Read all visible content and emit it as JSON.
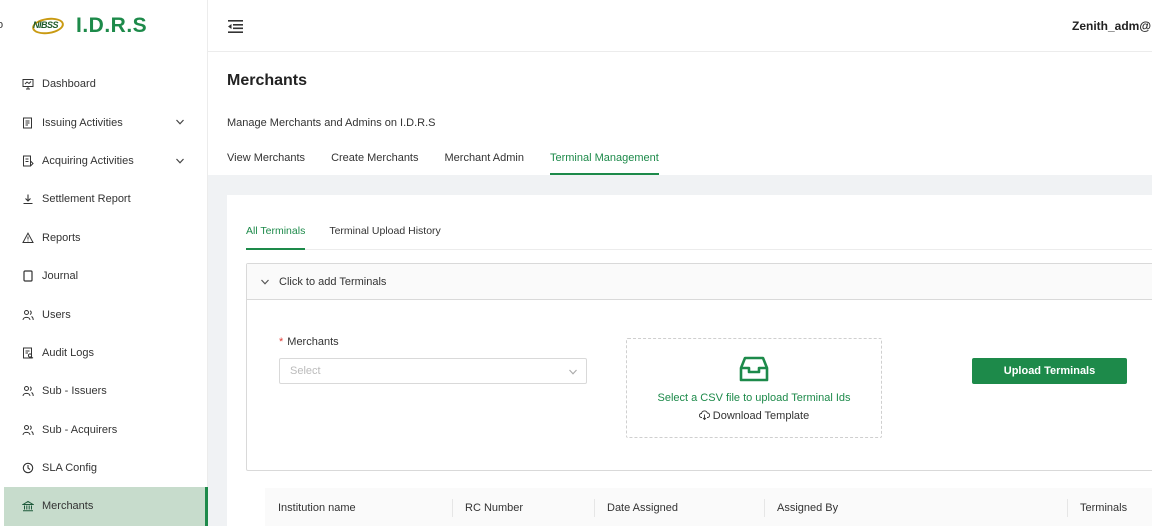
{
  "app": {
    "edge_mark": "o",
    "brand_title": "I.D.R.S",
    "logo_text": "NIBSS"
  },
  "sidebar": {
    "items": [
      {
        "label": "Dashboard",
        "icon": "dashboard-icon",
        "expandable": false
      },
      {
        "label": "Issuing Activities",
        "icon": "issuing-icon",
        "expandable": true
      },
      {
        "label": "Acquiring Activities",
        "icon": "acquiring-icon",
        "expandable": true
      },
      {
        "label": "Settlement Report",
        "icon": "download-icon",
        "expandable": false
      },
      {
        "label": "Reports",
        "icon": "warning-icon",
        "expandable": false
      },
      {
        "label": "Journal",
        "icon": "journal-icon",
        "expandable": false
      },
      {
        "label": "Users",
        "icon": "users-icon",
        "expandable": false
      },
      {
        "label": "Audit Logs",
        "icon": "audit-icon",
        "expandable": false
      },
      {
        "label": "Sub - Issuers",
        "icon": "users-icon",
        "expandable": false
      },
      {
        "label": "Sub - Acquirers",
        "icon": "users-icon",
        "expandable": false
      },
      {
        "label": "SLA Config",
        "icon": "clock-icon",
        "expandable": false
      },
      {
        "label": "Merchants",
        "icon": "bank-icon",
        "expandable": false,
        "active": true
      }
    ]
  },
  "header": {
    "user_name": "Zenith_adm@"
  },
  "page": {
    "title": "Merchants",
    "subtitle": "Manage Merchants and Admins on I.D.R.S",
    "tabs": [
      {
        "label": "View Merchants"
      },
      {
        "label": "Create Merchants"
      },
      {
        "label": "Merchant Admin"
      },
      {
        "label": "Terminal Management",
        "active": true
      }
    ]
  },
  "terminals": {
    "subtabs": [
      {
        "label": "All Terminals",
        "active": true
      },
      {
        "label": "Terminal Upload History"
      }
    ],
    "collapse_title": "Click to add Terminals",
    "merchants_label": "Merchants",
    "merchants_placeholder": "Select",
    "upload_hint": "Select a CSV file to upload Terminal Ids",
    "download_label": "Download Template",
    "upload_button": "Upload Terminals"
  },
  "table": {
    "columns": [
      "Institution name",
      "RC Number",
      "Date Assigned",
      "Assigned By",
      "Terminals"
    ]
  },
  "colors": {
    "accent": "#1d8a4a",
    "active_bg": "#c7dccc",
    "required": "#e0403a"
  }
}
